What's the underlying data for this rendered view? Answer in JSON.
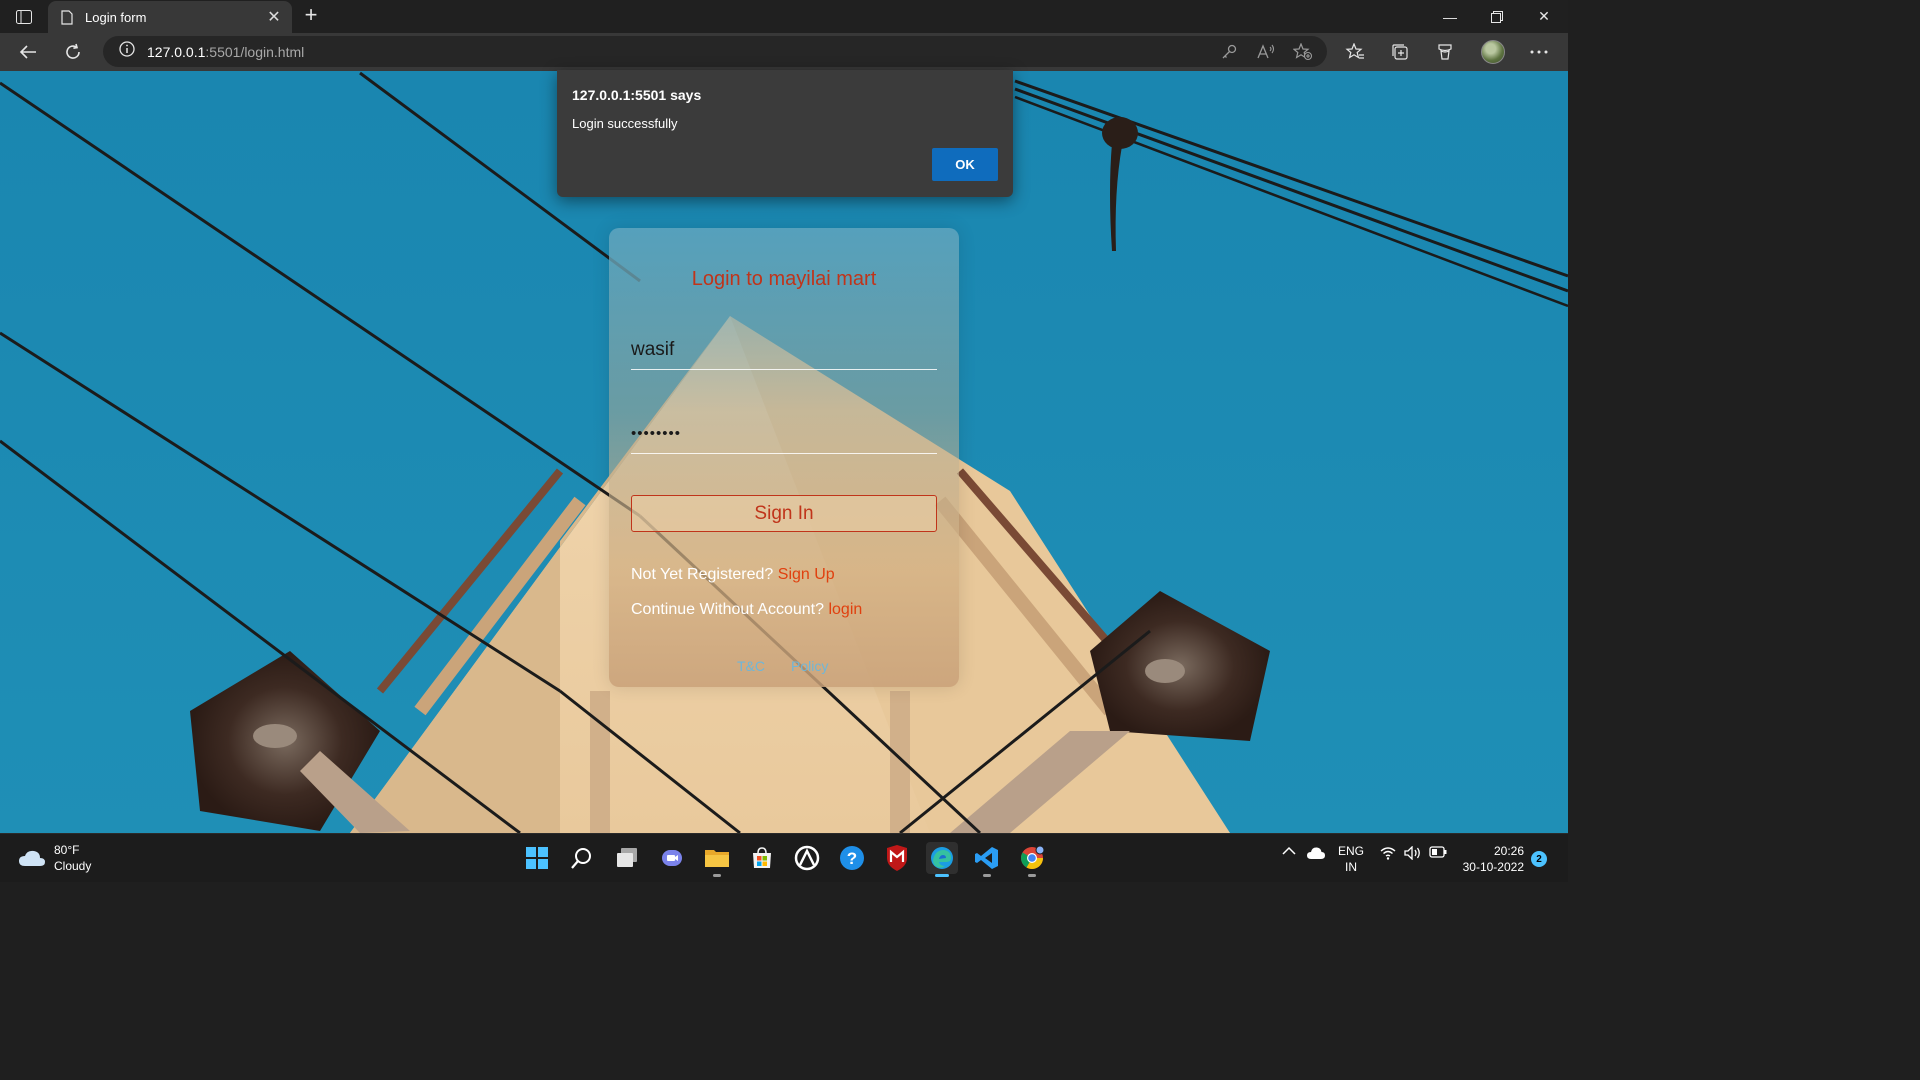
{
  "browser": {
    "tab_title": "Login form",
    "url_host": "127.0.0.1",
    "url_rest": ":5501/login.html"
  },
  "alert": {
    "header": "127.0.0.1:5501 says",
    "message": "Login successfully",
    "ok_label": "OK"
  },
  "login": {
    "title": "Login to mayilai mart",
    "username_value": "wasif",
    "password_value": "••••••••",
    "signin_label": "Sign In",
    "register_prompt": "Not Yet Registered?",
    "register_link": "Sign Up",
    "guest_prompt": "Continue Without Account?",
    "guest_link": "login",
    "footer_links": [
      "T&C",
      "Policy"
    ]
  },
  "taskbar": {
    "weather_temp": "80°F",
    "weather_desc": "Cloudy",
    "lang_top": "ENG",
    "lang_bottom": "IN",
    "time": "20:26",
    "date": "30-10-2022",
    "notification_count": "2"
  },
  "colors": {
    "accent_title": "#c0341a",
    "link": "#e0400f",
    "ok_button": "#0f6cbd",
    "sky": "#1789b2"
  }
}
